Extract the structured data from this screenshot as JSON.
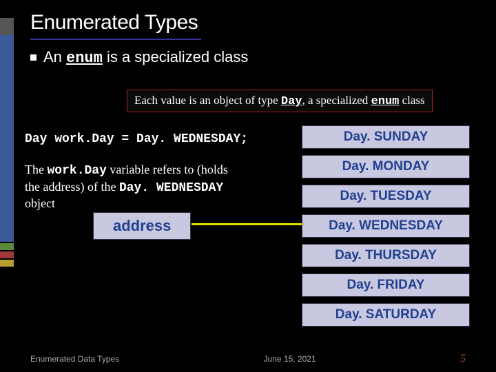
{
  "title": "Enumerated Types",
  "bullet": {
    "pre": "An ",
    "enum": "enum",
    "post": " is a specialized class"
  },
  "caption": {
    "pre": "Each value is an object of type ",
    "day": "Day",
    "mid": ", a specialized ",
    "enum": "enum",
    "post": " class"
  },
  "code": "Day work.Day = Day. WEDNESDAY;",
  "explain": {
    "l1_pre": "The ",
    "l1_mono": "work.Day",
    "l1_post": " variable refers to (holds",
    "l2_pre": "the address) of the ",
    "l2_mono": "Day. WEDNESDAY",
    "l3": "object"
  },
  "address_label": "address",
  "days": [
    "Day. SUNDAY",
    "Day. MONDAY",
    "Day. TUESDAY",
    "Day. WEDNESDAY",
    "Day. THURSDAY",
    "Day. FRIDAY",
    "Day. SATURDAY"
  ],
  "footer": {
    "left": "Enumerated Data Types",
    "center": "June 15, 2021",
    "right": "5"
  }
}
